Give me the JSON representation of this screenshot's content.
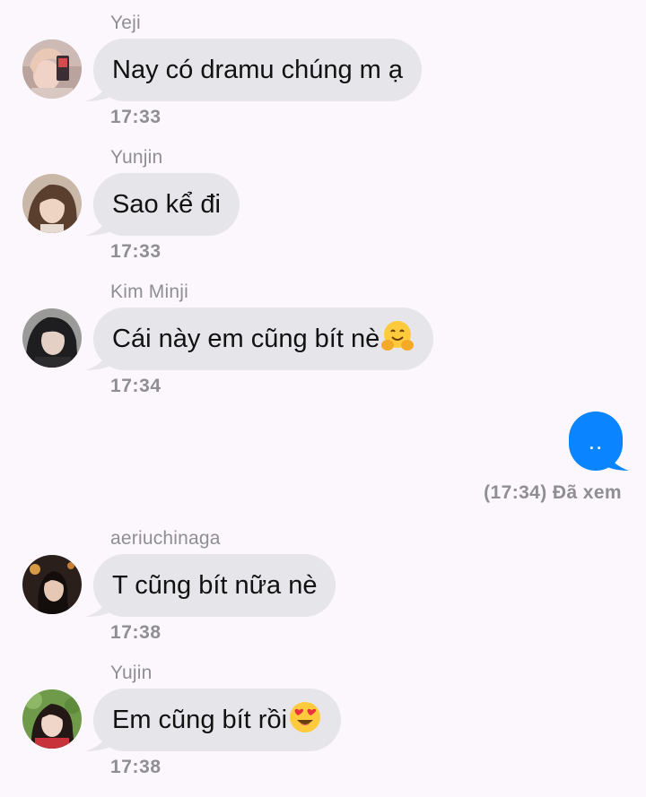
{
  "messages": [
    {
      "sender": "Yeji",
      "text": "Nay có dramu chúng m ạ",
      "time": "17:33",
      "emoji": ""
    },
    {
      "sender": "Yunjin",
      "text": "Sao kể đi",
      "time": "17:33",
      "emoji": ""
    },
    {
      "sender": "Kim Minji",
      "text": "Cái này em cũng bít nè",
      "time": "17:34",
      "emoji": "hugging-face-emoji"
    },
    {
      "sender": "aeriuchinaga",
      "text": "T cũng bít nữa nè",
      "time": "17:38",
      "emoji": ""
    },
    {
      "sender": "Yujin",
      "text": "Em cũng bít rồi",
      "time": "17:38",
      "emoji": "heart-eyes-emoji"
    }
  ],
  "outgoing": {
    "text": "..",
    "status": "(17:34) Đã xem"
  },
  "colors": {
    "background": "#fbf7fd",
    "incoming_bubble": "#e6e5ea",
    "outgoing_bubble": "#0a84ff",
    "meta_text": "#8e8e93"
  }
}
